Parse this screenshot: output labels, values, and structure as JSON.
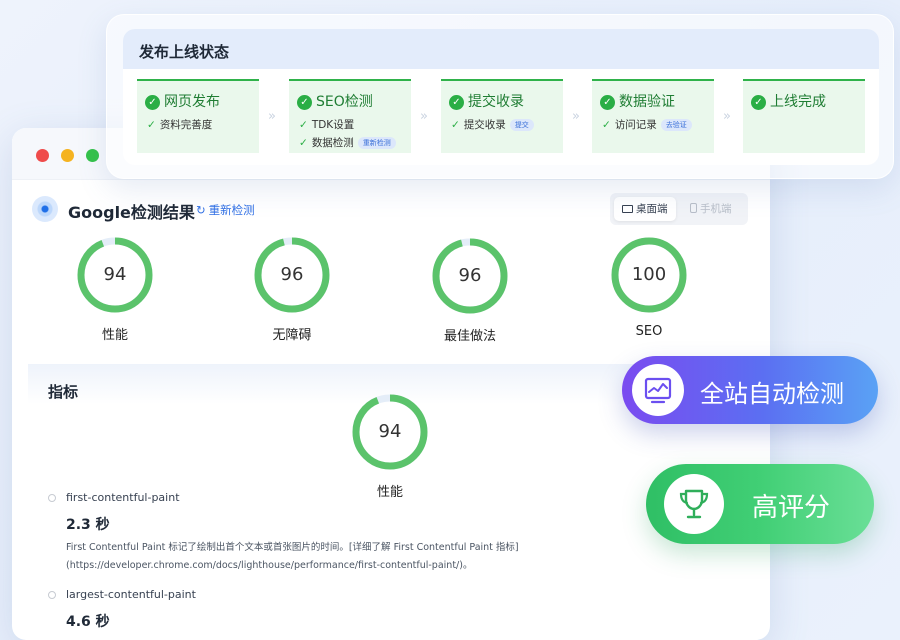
{
  "status": {
    "title": "发布上线状态",
    "steps": [
      {
        "title": "网页发布",
        "subs": [
          {
            "text": "资料完善度",
            "pill": ""
          }
        ]
      },
      {
        "title": "SEO检测",
        "subs": [
          {
            "text": "TDK设置",
            "pill": ""
          },
          {
            "text": "数据检测",
            "pill": "重新检测"
          }
        ]
      },
      {
        "title": "提交收录",
        "subs": [
          {
            "text": "提交收录",
            "pill": "提交"
          }
        ]
      },
      {
        "title": "数据验证",
        "subs": [
          {
            "text": "访问记录",
            "pill": "去验证"
          }
        ]
      },
      {
        "title": "上线完成",
        "subs": []
      }
    ],
    "separator": "»"
  },
  "browser": {
    "title": "Google检测结果",
    "recheck": "重新检测",
    "recheck_icon": "↻",
    "device_tabs": {
      "desktop": "桌面端",
      "mobile": "手机端",
      "selected": "desktop"
    }
  },
  "scores": [
    {
      "value": "94",
      "label": "性能",
      "fraction": 0.94
    },
    {
      "value": "96",
      "label": "无障碍",
      "fraction": 0.96
    },
    {
      "value": "96",
      "label": "最佳做法",
      "fraction": 0.96
    },
    {
      "value": "100",
      "label": "SEO",
      "fraction": 1.0
    }
  ],
  "metrics": {
    "title": "指标",
    "overall": {
      "value": "94",
      "label": "性能",
      "fraction": 0.94
    },
    "items": [
      {
        "name": "first-contentful-paint",
        "value": "2.3 秒",
        "desc1": "First Contentful Paint 标记了绘制出首个文本或首张图片的时间。[详细了解 First Contentful Paint 指标]",
        "desc2": "(https://developer.chrome.com/docs/lighthouse/performance/first-contentful-paint/)。"
      },
      {
        "name": "largest-contentful-paint",
        "value": "4.6 秒"
      }
    ]
  },
  "promos": {
    "auto_check": "全站自动检测",
    "high_score": "高评分"
  },
  "colors": {
    "ring_green": "#5bc36b",
    "ring_track": "#e4edf8",
    "step_green": "#2aae45",
    "accent_blue": "#2f6fe4"
  }
}
